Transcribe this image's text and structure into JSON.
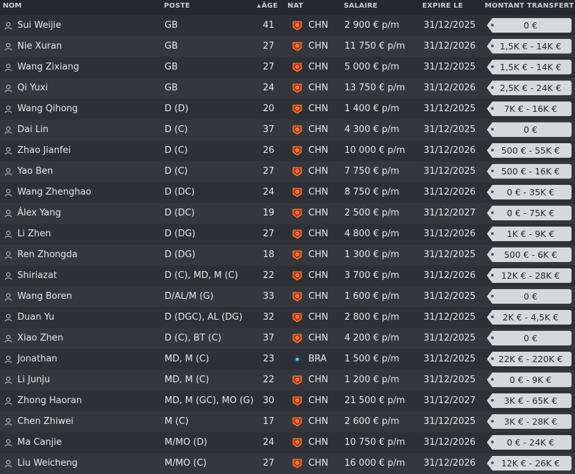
{
  "columns": {
    "name": "NOM",
    "position": "POSTE",
    "age": "ÂGE",
    "nationality": "NAT",
    "salary": "SALAIRE",
    "expires": "EXPIRE LE",
    "transfer_value": "MONTANT TRANSFERT"
  },
  "sort": {
    "column": "age",
    "icon": "sort-up-icon"
  },
  "colors": {
    "background": "#2b2d33",
    "row_alt": "#35373d",
    "tag_background": "#d7d8db",
    "flag_china": "#d52b1e",
    "flag_china_star": "#f7c21b",
    "flag_brazil": "#1a4b7a"
  },
  "players": [
    {
      "name": "Sui Weijie",
      "position": "GB",
      "age": "41",
      "flag": "chn",
      "nat": "CHN",
      "salary": "2 900 € p/m",
      "expires": "31/12/2025",
      "value": "0 €"
    },
    {
      "name": "Nie Xuran",
      "position": "GB",
      "age": "27",
      "flag": "chn",
      "nat": "CHN",
      "salary": "11 750 € p/m",
      "expires": "31/12/2026",
      "value": "1,5K € - 14K €"
    },
    {
      "name": "Wang Zixiang",
      "position": "GB",
      "age": "27",
      "flag": "chn",
      "nat": "CHN",
      "salary": "5 000 € p/m",
      "expires": "31/12/2025",
      "value": "1,5K € - 14K €"
    },
    {
      "name": "Qi Yuxi",
      "position": "GB",
      "age": "24",
      "flag": "chn",
      "nat": "CHN",
      "salary": "13 750 € p/m",
      "expires": "31/12/2026",
      "value": "2,5K € - 24K €"
    },
    {
      "name": "Wang Qihong",
      "position": "D (D)",
      "age": "20",
      "flag": "chn",
      "nat": "CHN",
      "salary": "1 400 € p/m",
      "expires": "31/12/2025",
      "value": "7K € - 16K €"
    },
    {
      "name": "Dai Lin",
      "position": "D (C)",
      "age": "37",
      "flag": "chn",
      "nat": "CHN",
      "salary": "4 300 € p/m",
      "expires": "31/12/2025",
      "value": "0 €"
    },
    {
      "name": "Zhao Jianfei",
      "position": "D (C)",
      "age": "26",
      "flag": "chn",
      "nat": "CHN",
      "salary": "10 000 € p/m",
      "expires": "31/12/2026",
      "value": "500 € - 55K €"
    },
    {
      "name": "Yao Ben",
      "position": "D (C)",
      "age": "27",
      "flag": "chn",
      "nat": "CHN",
      "salary": "7 750 € p/m",
      "expires": "31/12/2025",
      "value": "500 € - 16K €"
    },
    {
      "name": "Wang Zhenghao",
      "position": "D (DC)",
      "age": "24",
      "flag": "chn",
      "nat": "CHN",
      "salary": "8 750 € p/m",
      "expires": "31/12/2026",
      "value": "0 € - 35K €"
    },
    {
      "name": "Álex Yang",
      "position": "D (DC)",
      "age": "19",
      "flag": "chn",
      "nat": "CHN",
      "salary": "2 500 € p/m",
      "expires": "31/12/2027",
      "value": "0 € - 75K €"
    },
    {
      "name": "Li Zhen",
      "position": "D (DG)",
      "age": "27",
      "flag": "chn",
      "nat": "CHN",
      "salary": "4 800 € p/m",
      "expires": "31/12/2026",
      "value": "1K € - 9K €"
    },
    {
      "name": "Ren Zhongda",
      "position": "D (DG)",
      "age": "18",
      "flag": "chn",
      "nat": "CHN",
      "salary": "1 300 € p/m",
      "expires": "31/12/2025",
      "value": "500 € - 6K €"
    },
    {
      "name": "Shiriazat",
      "position": "D (C), MD, M (C)",
      "age": "22",
      "flag": "chn",
      "nat": "CHN",
      "salary": "3 700 € p/m",
      "expires": "31/12/2026",
      "value": "12K € - 28K €"
    },
    {
      "name": "Wang Boren",
      "position": "D/AL/M (G)",
      "age": "33",
      "flag": "chn",
      "nat": "CHN",
      "salary": "1 600 € p/m",
      "expires": "31/12/2025",
      "value": "0 €"
    },
    {
      "name": "Duan Yu",
      "position": "D (DGC), AL (DG)",
      "age": "32",
      "flag": "chn",
      "nat": "CHN",
      "salary": "2 800 € p/m",
      "expires": "31/12/2025",
      "value": "2K € - 4,5K €"
    },
    {
      "name": "Xiao Zhen",
      "position": "D (C), BT (C)",
      "age": "37",
      "flag": "chn",
      "nat": "CHN",
      "salary": "4 200 € p/m",
      "expires": "31/12/2025",
      "value": "0 €"
    },
    {
      "name": "Jonathan",
      "position": "MD, M (C)",
      "age": "23",
      "flag": "bra",
      "nat": "BRA",
      "salary": "1 500 € p/m",
      "expires": "31/12/2025",
      "value": "22K € - 220K €"
    },
    {
      "name": "Li Junju",
      "position": "MD, M (C)",
      "age": "22",
      "flag": "chn",
      "nat": "CHN",
      "salary": "1 200 € p/m",
      "expires": "31/12/2025",
      "value": "0 € - 9K €"
    },
    {
      "name": "Zhong Haoran",
      "position": "MD, M (GC), MO (G)",
      "age": "30",
      "flag": "chn",
      "nat": "CHN",
      "salary": "21 500 € p/m",
      "expires": "31/12/2027",
      "value": "3K € - 65K €"
    },
    {
      "name": "Chen Zhiwei",
      "position": "M (C)",
      "age": "17",
      "flag": "chn",
      "nat": "CHN",
      "salary": "2 600 € p/m",
      "expires": "31/12/2025",
      "value": "3K € - 28K €"
    },
    {
      "name": "Ma Canjie",
      "position": "M/MO (D)",
      "age": "24",
      "flag": "chn",
      "nat": "CHN",
      "salary": "10 750 € p/m",
      "expires": "31/12/2026",
      "value": "0 € - 24K €"
    },
    {
      "name": "Liu Weicheng",
      "position": "M/MO (C)",
      "age": "27",
      "flag": "chn",
      "nat": "CHN",
      "salary": "16 000 € p/m",
      "expires": "31/12/2026",
      "value": "12K € - 26K €"
    }
  ]
}
